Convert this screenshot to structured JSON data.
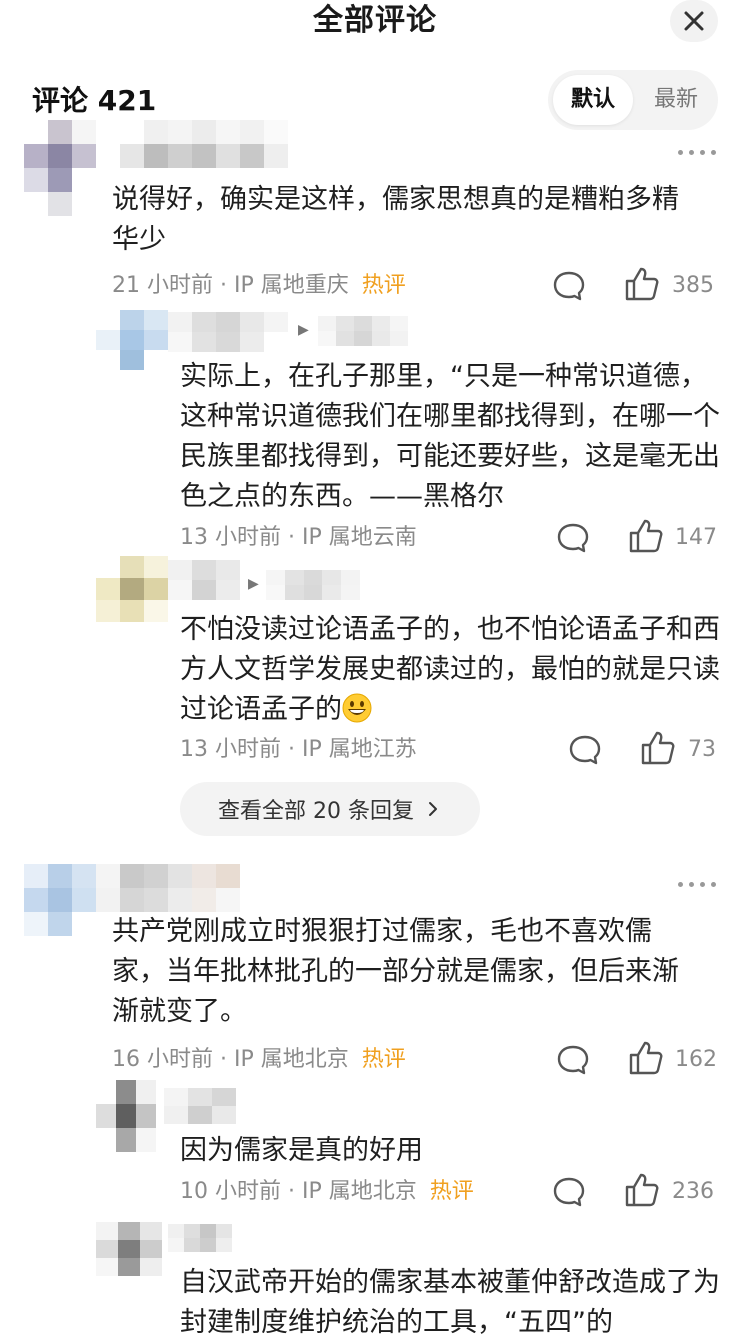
{
  "header": {
    "title": "全部评论"
  },
  "comments_count_label": "评论 421",
  "sort": {
    "default_label": "默认",
    "latest_label": "最新"
  },
  "hot_label": "热评",
  "comments": [
    {
      "text": "说得好，确实是这样，儒家思想真的是糟粕多精华少",
      "time": "21 小时前",
      "ip": "· IP 属地重庆",
      "hot": true,
      "likes": "385",
      "replies": [
        {
          "text": "实际上，在孔子那里，“只是一种常识道德，这种常识道德我们在哪里都找得到，在哪一个民族里都找得到，可能还要好些，这是毫无出色之点的东西。——黑格尔",
          "time": "13 小时前",
          "ip": "· IP 属地云南",
          "likes": "147"
        },
        {
          "text": "不怕没读过论语孟子的，也不怕论语孟子和西方人文哲学发展史都读过的，最怕的就是只读过论语孟子的",
          "time": "13 小时前",
          "ip": "· IP 属地江苏",
          "likes": "73"
        }
      ],
      "view_all_label": "查看全部 20 条回复"
    },
    {
      "text": "共产党刚成立时狠狠打过儒家，毛也不喜欢儒家，当年批林批孔的一部分就是儒家，但后来渐渐就变了。",
      "time": "16 小时前",
      "ip": "· IP 属地北京",
      "hot": true,
      "likes": "162",
      "replies": [
        {
          "text": "因为儒家是真的好用",
          "time": "10 小时前",
          "ip": "· IP 属地北京",
          "hot": true,
          "likes": "236"
        },
        {
          "text": "自汉武帝开始的儒家基本被董仲舒改造成了为封建制度维护统治的工具，“五四”的"
        }
      ]
    }
  ],
  "icons": {
    "close": "close-icon",
    "more": "more-dots-icon",
    "reply": "comment-bubble-icon",
    "like": "thumbs-up-icon",
    "emoji": "grinning-face-emoji"
  },
  "colors": {
    "hot": "#f0a020",
    "meta": "#8a8a8a",
    "text": "#1f1f1f"
  }
}
